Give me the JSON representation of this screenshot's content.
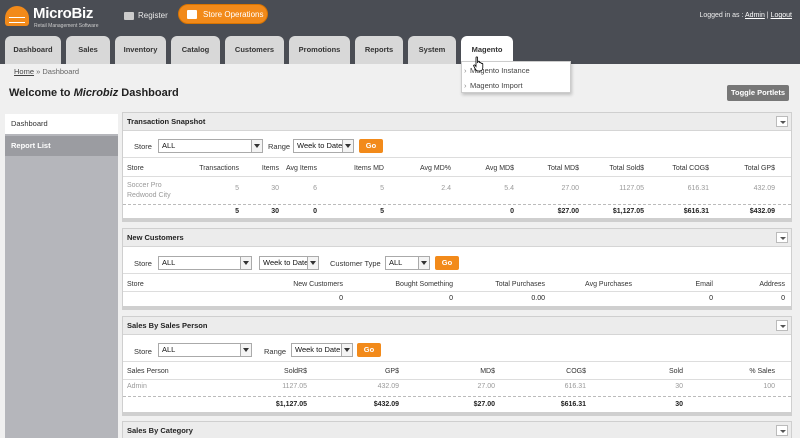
{
  "app": {
    "name": "MicroBiz",
    "tagline": "Retail Management Software"
  },
  "header": {
    "register_label": "Register",
    "store_ops_label": "Store Operations",
    "logged_in_prefix": "Logged in as :",
    "user": "Admin",
    "separator": " | ",
    "logout": "Logout"
  },
  "nav": {
    "tabs": [
      "Dashboard",
      "Sales",
      "Inventory",
      "Catalog",
      "Customers",
      "Promotions",
      "Reports",
      "System",
      "Magento"
    ],
    "active": "Magento"
  },
  "magento_menu": {
    "items": [
      "Magento Instance",
      "Magento Import"
    ]
  },
  "breadcrumb": {
    "home": "Home",
    "sep": "»",
    "current": "Dashboard"
  },
  "page": {
    "title_pre": "Welcome to ",
    "title_brand": "Microbiz",
    "title_post": " Dashboard",
    "toggle_label": "Toggle Portlets"
  },
  "sidebar": {
    "items": [
      "Dashboard",
      "Report List"
    ]
  },
  "transaction": {
    "title": "Transaction Snapshot",
    "store_label": "Store",
    "store_value": "ALL",
    "range_label": "Range",
    "range_value": "Week to Date",
    "go": "Go",
    "headers": [
      "Store",
      "Transactions",
      "Items",
      "Avg Items",
      "Items MD",
      "Avg MD%",
      "Avg MD$",
      "Total MD$",
      "Total Sold$",
      "Total COG$",
      "Total GP$"
    ],
    "row": {
      "store_line1": "Soccer Pro",
      "store_line2": "Redwood City",
      "values": [
        "5",
        "30",
        "6",
        "5",
        "2.4",
        "5.4",
        "27.00",
        "1127.05",
        "616.31",
        "432.09"
      ]
    },
    "totals": [
      "5",
      "30",
      "0",
      "5",
      "0",
      "$27.00",
      "$1,127.05",
      "$616.31",
      "$432.09"
    ]
  },
  "customers": {
    "title": "New Customers",
    "store_label": "Store",
    "store_value": "ALL",
    "range_value": "Week to Date",
    "type_label": "Customer Type",
    "type_value": "ALL",
    "go": "Go",
    "headers": [
      "Store",
      "New Customers",
      "Bought Something",
      "Total Purchases",
      "Avg Purchases",
      "Email",
      "Address"
    ],
    "values": [
      "0",
      "0",
      "0.00",
      "0",
      "0"
    ]
  },
  "salesperson": {
    "title": "Sales By Sales Person",
    "store_label": "Store",
    "store_value": "ALL",
    "range_label": "Range",
    "range_value": "Week to Date",
    "go": "Go",
    "headers": [
      "Sales Person",
      "SoldR$",
      "GP$",
      "MD$",
      "COG$",
      "Sold",
      "% Sales"
    ],
    "row": [
      "Admin",
      "1127.05",
      "432.09",
      "27.00",
      "616.31",
      "30",
      "100"
    ],
    "totals": [
      "$1,127.05",
      "$432.09",
      "$27.00",
      "$616.31",
      "30"
    ]
  },
  "category": {
    "title": "Sales By Category"
  },
  "colors": {
    "topbar": "#4a4d54",
    "accent": "#f28a1a",
    "sidebar": "#b5b6bb"
  }
}
